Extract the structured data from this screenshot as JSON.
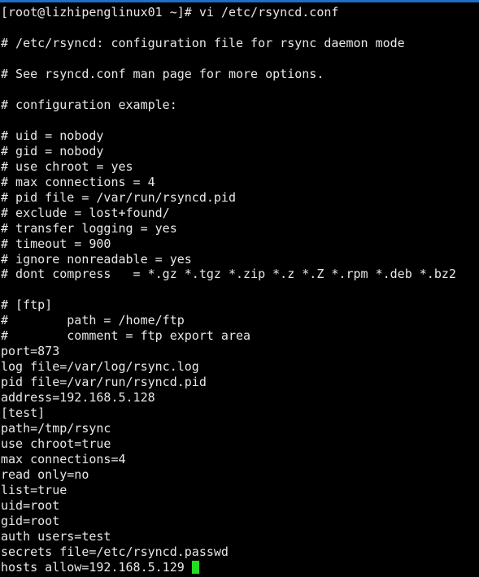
{
  "colors": {
    "background": "#000000",
    "text": "#e8e8e8",
    "cursor": "#22dd22",
    "titlebar": "#1e6fc8"
  },
  "terminal": {
    "lines": [
      "[root@lizhipenglinux01 ~]# vi /etc/rsyncd.conf",
      "",
      "# /etc/rsyncd: configuration file for rsync daemon mode",
      "",
      "# See rsyncd.conf man page for more options.",
      "",
      "# configuration example:",
      "",
      "# uid = nobody",
      "# gid = nobody",
      "# use chroot = yes",
      "# max connections = 4",
      "# pid file = /var/run/rsyncd.pid",
      "# exclude = lost+found/",
      "# transfer logging = yes",
      "# timeout = 900",
      "# ignore nonreadable = yes",
      "# dont compress   = *.gz *.tgz *.zip *.z *.Z *.rpm *.deb *.bz2",
      "",
      "# [ftp]",
      "#        path = /home/ftp",
      "#        comment = ftp export area",
      "port=873",
      "log file=/var/log/rsync.log",
      "pid file=/var/run/rsyncd.pid",
      "address=192.168.5.128",
      "[test]",
      "path=/tmp/rsync",
      "use chroot=true",
      "max connections=4",
      "read only=no",
      "list=true",
      "uid=root",
      "gid=root",
      "auth users=test",
      "secrets file=/etc/rsyncd.passwd",
      "hosts allow=192.168.5.129"
    ]
  }
}
